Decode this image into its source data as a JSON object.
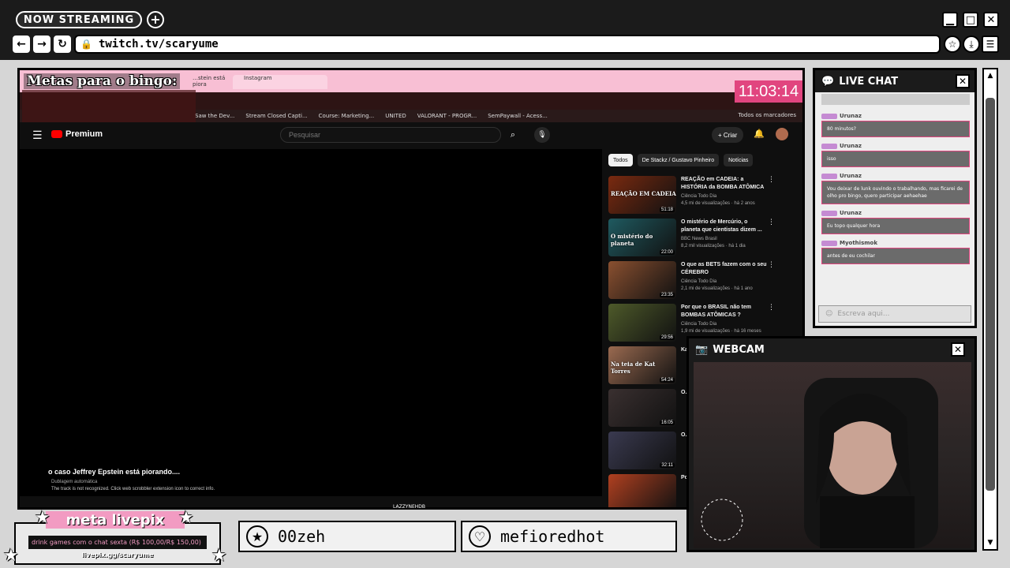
{
  "titlebar": {
    "now_streaming": "NOW STREAMING",
    "plus": "+",
    "minimize": "▁",
    "maximize": "□",
    "close": "✕"
  },
  "addressbar": {
    "back": "←",
    "forward": "→",
    "reload": "↻",
    "url": "twitch.tv/scaryume"
  },
  "capture": {
    "metas_title": "Metas para o bingo:",
    "clock": "11:03:14",
    "inner_tab_1": "…stein está piora",
    "inner_tab_2": "Instagram",
    "bookmarks": [
      "Saw the Dev...",
      "Stream Closed Capti...",
      "Course: Marketing...",
      "UNITED",
      "VALORANT - PROGR...",
      "SemPaywall - Acess..."
    ],
    "bookmarks_right": "Todos os marcadores",
    "youtube": {
      "logo": "Premium",
      "search_placeholder": "Pesquisar",
      "create": "+ Criar",
      "chips": [
        "Todos",
        "De Stackz / Gustavo Pinheiro",
        "Notícias"
      ],
      "player_title": "o caso Jeffrey Epstein está piorando....",
      "player_dub": "Dublagem automática",
      "player_scrobbler": "The track is not recognized. Click web scrobbler extension icon to correct info.",
      "videos": [
        {
          "title": "REAÇÃO em CADEIA: a HISTÓRIA da BOMBA ATÔMICA",
          "channel": "Ciência Todo Dia",
          "meta": "4,5 mi de visualizações · há 2 anos",
          "duration": "51:18",
          "thumb_text": "REAÇÃO EM CADEIA",
          "color": "#7a2a10"
        },
        {
          "title": "O mistério de Mercúrio, o planeta que cientistas dizem ...",
          "channel": "BBC News Brasil",
          "meta": "8,2 mil visualizações · há 1 dia",
          "duration": "22:00",
          "thumb_text": "O mistério do planeta",
          "color": "#1f5a60"
        },
        {
          "title": "O que as BETS fazem com o seu CÉREBRO",
          "channel": "Ciência Todo Dia",
          "meta": "2,1 mi de visualizações · há 1 ano",
          "duration": "23:35",
          "thumb_text": "",
          "color": "#8a5030"
        },
        {
          "title": "Por que o BRASIL não tem BOMBAS ATÔMICAS ?",
          "channel": "Ciência Todo Dia",
          "meta": "1,9 mi de visualizações · há 16 meses",
          "duration": "29:56",
          "thumb_text": "",
          "color": "#4e5a2a"
        },
        {
          "title": "Ka...",
          "channel": "",
          "meta": "",
          "duration": "54:24",
          "thumb_text": "Na teia de Kat Torres",
          "color": "#9a6a50"
        },
        {
          "title": "O...",
          "channel": "",
          "meta": "",
          "duration": "16:05",
          "thumb_text": "",
          "color": "#3a3030"
        },
        {
          "title": "O...",
          "channel": "",
          "meta": "",
          "duration": "32:11",
          "thumb_text": "",
          "color": "#3a3a50"
        },
        {
          "title": "Po...",
          "channel": "",
          "meta": "",
          "duration": "",
          "thumb_text": "",
          "color": "#b04020"
        }
      ]
    }
  },
  "bottom": {
    "livepix_title": "meta livepix",
    "livepix_bar": "drink games com o chat sexta (R$ 100,00/R$ 150,00)",
    "livepix_link": "livepix.gg/scaryume",
    "user_1": "00zeh",
    "user_2": "mefioredhot",
    "lazzy": "LAZZYNEHDB"
  },
  "chat": {
    "title": "LIVE CHAT",
    "close": "✕",
    "messages": [
      {
        "user": "Urunaz",
        "text": "80 minutos?"
      },
      {
        "user": "Urunaz",
        "text": "isso"
      },
      {
        "user": "Urunaz",
        "text": "Vou deixar de lunk ouvindo o trabalhando, mas ficarei de olho pro bingo, quero participar aehaehae"
      },
      {
        "user": "Urunaz",
        "text": "Eu topo qualquer hora"
      },
      {
        "user": "Myothismok",
        "text": "antes de eu cochilar"
      }
    ],
    "input_placeholder": "Escreva aqui..."
  },
  "webcam": {
    "title": "WEBCAM",
    "close": "✕"
  },
  "colors": {
    "accent": "#e1457f",
    "pink": "#f29bc2",
    "dark": "#1b1b1b"
  }
}
